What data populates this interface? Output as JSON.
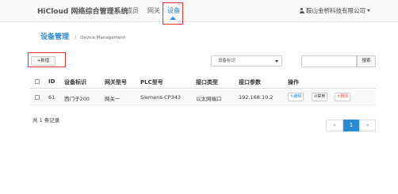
{
  "header": {
    "brand": "HiCloud 网络综合管理系统",
    "nav": [
      {
        "label": "成员"
      },
      {
        "label": "网关"
      },
      {
        "label": "设备",
        "active": true
      }
    ],
    "user": "鞍山金桥科技有限公司"
  },
  "page": {
    "title": "设备管理",
    "separator": "/",
    "subtitle": "Device Management"
  },
  "toolbar": {
    "add_label": "+新增",
    "filter_selected": "设备标识",
    "search_value": "",
    "search_label": "搜索"
  },
  "table": {
    "columns": [
      "ID",
      "设备标识",
      "网关型号",
      "PLC型号",
      "接口类型",
      "接口参数",
      "操作"
    ],
    "rows": [
      {
        "id": "61",
        "device_id": "西门子200",
        "gateway_model": "网关一",
        "plc_model": "Siemens-CP343",
        "interface_type": "以太网端口",
        "interface_params": "192.168.10.2",
        "actions": {
          "edit": "编辑",
          "disable": "禁用",
          "delete": "删除"
        }
      }
    ]
  },
  "footer": {
    "total": "共 1 条记录"
  },
  "pagination": {
    "prev": "«",
    "current": "1",
    "next": "»"
  },
  "colors": {
    "accent": "#2a8bd0",
    "highlight_box": "#e03030",
    "danger": "#d9534f"
  }
}
